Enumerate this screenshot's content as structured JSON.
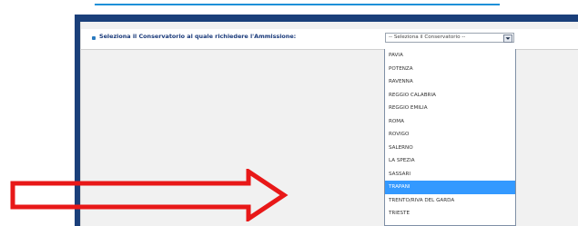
{
  "form": {
    "prompt": "Seleziona il Conservatorio al quale richiedere l'Ammissione:",
    "select_value": "-- Seleziona il Conservatorio --"
  },
  "dropdown": {
    "options": [
      "PAVIA",
      "POTENZA",
      "RAVENNA",
      "REGGIO CALABRIA",
      "REGGIO EMILIA",
      "ROMA",
      "ROVIGO",
      "SALERNO",
      "LA SPEZIA",
      "SASSARI",
      "TRAPANI",
      "TRENTO/RIVA DEL GARDA",
      "TRIESTE"
    ],
    "selected_index": 10
  },
  "colors": {
    "accent_rule": "#1e90d8",
    "frame": "#1a3f7a",
    "selected_highlight": "#3399ff",
    "arrow": "#e81818"
  }
}
